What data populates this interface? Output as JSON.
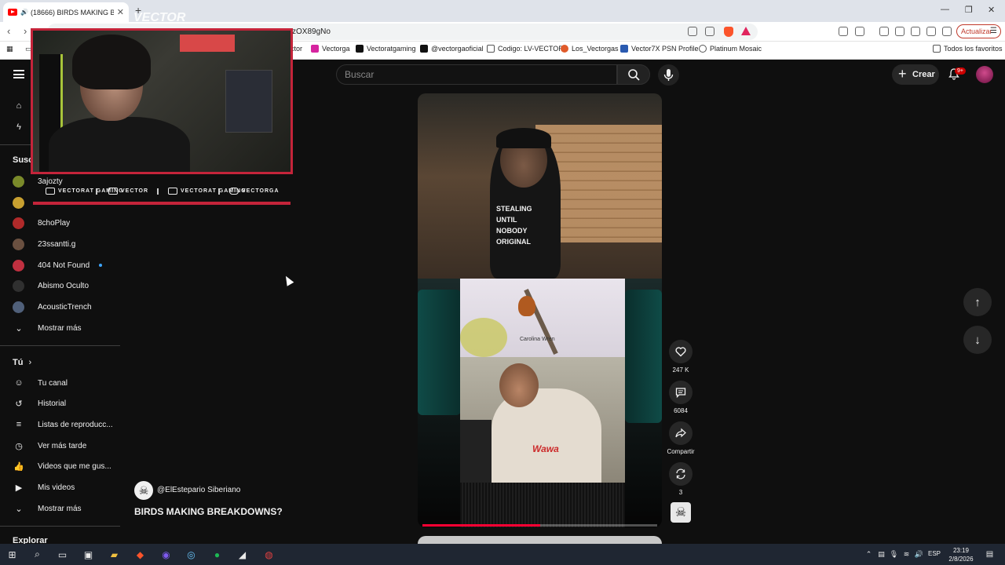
{
  "browser": {
    "tab_title": "(18666) BIRDS MAKING BREAKDOWNS?",
    "url_visible": "zOX89gNo",
    "update_label": "Actualizar",
    "bookmarks": [
      {
        "label": "ctor",
        "color": "#888888"
      },
      {
        "label": "Vectorga",
        "color": "#d6249f"
      },
      {
        "label": "Vectoratgaming",
        "color": "#111111"
      },
      {
        "label": "@vectorgaoficial",
        "color": "#111111"
      },
      {
        "label": "Codigo: LV-VECTOR",
        "color": "#333333"
      },
      {
        "label": "Los_Vectorgas",
        "color": "#e05a2a"
      },
      {
        "label": "Vector7X PSN Profile",
        "color": "#2a5ab0"
      },
      {
        "label": "Platinum Mosaic",
        "color": "#444444"
      }
    ],
    "all_bookmarks": "Todos los favoritos"
  },
  "header": {
    "search_placeholder": "Buscar",
    "create_label": "Crear",
    "notif_badge": "9+"
  },
  "sidebar": {
    "subs_heading": "Susc",
    "channels": [
      {
        "name": "3ajozty",
        "color": "#7a8a2a"
      },
      {
        "name": "",
        "color": "#c8a030"
      },
      {
        "name": "8choPlay",
        "color": "#b02a2a"
      },
      {
        "name": "23ssantti.g",
        "color": "#6a5040"
      },
      {
        "name": "404 Not Found",
        "color": "#c03040"
      },
      {
        "name": "Abismo Oculto",
        "color": "#303030"
      },
      {
        "name": "AcousticTrench",
        "color": "#50607a"
      }
    ],
    "show_more": "Mostrar más",
    "you_heading": "Tú",
    "you_items": [
      "Tu canal",
      "Historial",
      "Listas de reproducc...",
      "Ver más tarde",
      "Videos que me gus...",
      "Mis videos",
      "Mostrar más"
    ],
    "explore_heading": "Explorar"
  },
  "overlay": {
    "brand_text": "VECTOR",
    "socials": [
      "VECTORAT GAMING",
      "VECTOR",
      "VECTORAT GAMING",
      "VECTORGA"
    ]
  },
  "short": {
    "shirt_lines": [
      "STEALING",
      "UNTIL",
      "NOBODY",
      "ORIGINAL"
    ],
    "bird_caption": "Carolina Wren",
    "guitar_shirt": "Wawa",
    "progress": 0.5,
    "channel": "@ElEstepario Siberiano",
    "title": "BIRDS MAKING BREAKDOWNS?"
  },
  "actions": {
    "likes": "247 K",
    "comments": "6084",
    "share": "Compartir",
    "remix": "3"
  },
  "taskbar": {
    "lang": "ESP",
    "time": "23:19",
    "date": "2/8/2026"
  }
}
